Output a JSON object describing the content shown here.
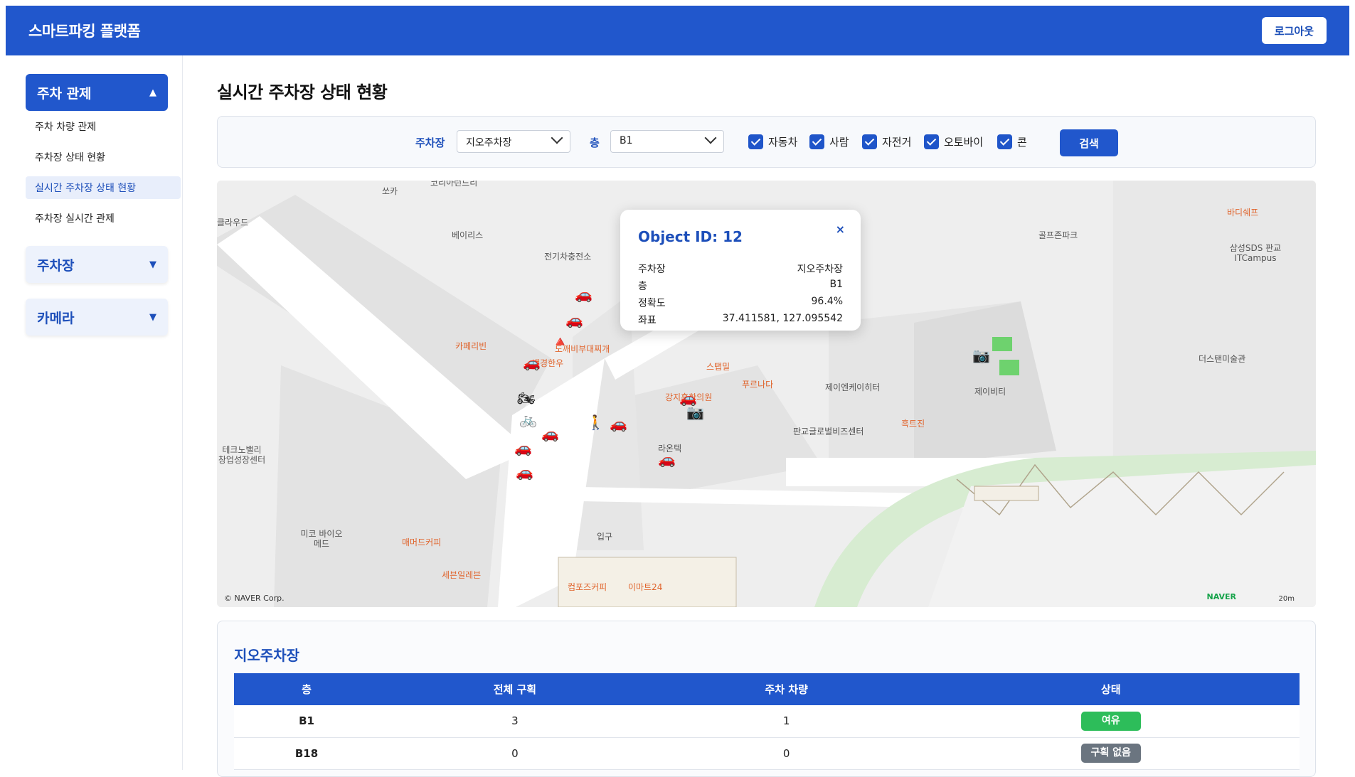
{
  "header": {
    "title": "스마트파킹 플랫폼",
    "logout_label": "로그아웃"
  },
  "sidebar": {
    "groups": [
      {
        "label": "주차 관제",
        "caret": "▲",
        "expanded": true,
        "items": [
          {
            "label": "주차 차량 관제",
            "selected": false
          },
          {
            "label": "주차장 상태 현황",
            "selected": false
          },
          {
            "label": "실시간 주차장 상태 현황",
            "selected": true
          },
          {
            "label": "주차장 실시간 관제",
            "selected": false
          }
        ]
      },
      {
        "label": "주차장",
        "caret": "▼",
        "expanded": false
      },
      {
        "label": "카메라",
        "caret": "▼",
        "expanded": false
      }
    ]
  },
  "page": {
    "title": "실시간 주차장 상태 현황"
  },
  "filter": {
    "lot_label": "주차장",
    "lot_value": "지오주차장",
    "floor_label": "층",
    "floor_value": "B1",
    "checkboxes": [
      {
        "label": "자동차",
        "checked": true
      },
      {
        "label": "사람",
        "checked": true
      },
      {
        "label": "자전거",
        "checked": true
      },
      {
        "label": "오토바이",
        "checked": true
      },
      {
        "label": "콘",
        "checked": true
      }
    ],
    "search_label": "검색"
  },
  "map": {
    "pois": [
      "쏘카",
      "코리아런드리",
      "클라우드",
      "베이리스",
      "전기차충전소",
      "카페리빈",
      "백경한우",
      "스탭밀",
      "푸르나다",
      "강지훈한의원",
      "제이엔케이히터",
      "판교글로벌비즈센터",
      "라온텍",
      "제이비티",
      "골프존파크",
      "바디쉐프",
      "삼성SDS 판교ITCampus",
      "더스탠미술관",
      "테크노밸리 창업성장센터",
      "미코 바이오메드",
      "매머드커피",
      "세븐일레븐",
      "입구",
      "이마트24",
      "컴포즈커피",
      "도깨비부대찌개",
      "흑트진"
    ],
    "copyright": "© NAVER Corp.",
    "naver": "NAVER",
    "scale": "20m"
  },
  "popup": {
    "title": "Object ID: 12",
    "close": "×",
    "rows": [
      {
        "label": "주차장",
        "value": "지오주차장"
      },
      {
        "label": "층",
        "value": "B1"
      },
      {
        "label": "정확도",
        "value": "96.4%"
      },
      {
        "label": "좌표",
        "value": "37.411581, 127.095542"
      }
    ]
  },
  "table": {
    "title": "지오주차장",
    "headers": [
      "층",
      "전체 구획",
      "주차 차량",
      "상태"
    ],
    "rows": [
      {
        "floor": "B1",
        "total": "3",
        "parked": "1",
        "status": "여유",
        "status_color": "#2dbd5a"
      },
      {
        "floor": "B18",
        "total": "0",
        "parked": "0",
        "status": "구획 없음",
        "status_color": "#6b7580"
      }
    ]
  },
  "colors": {
    "primary": "#2157cc",
    "ok": "#2dbd5a",
    "none": "#6b7580",
    "car": "#d8243f"
  }
}
